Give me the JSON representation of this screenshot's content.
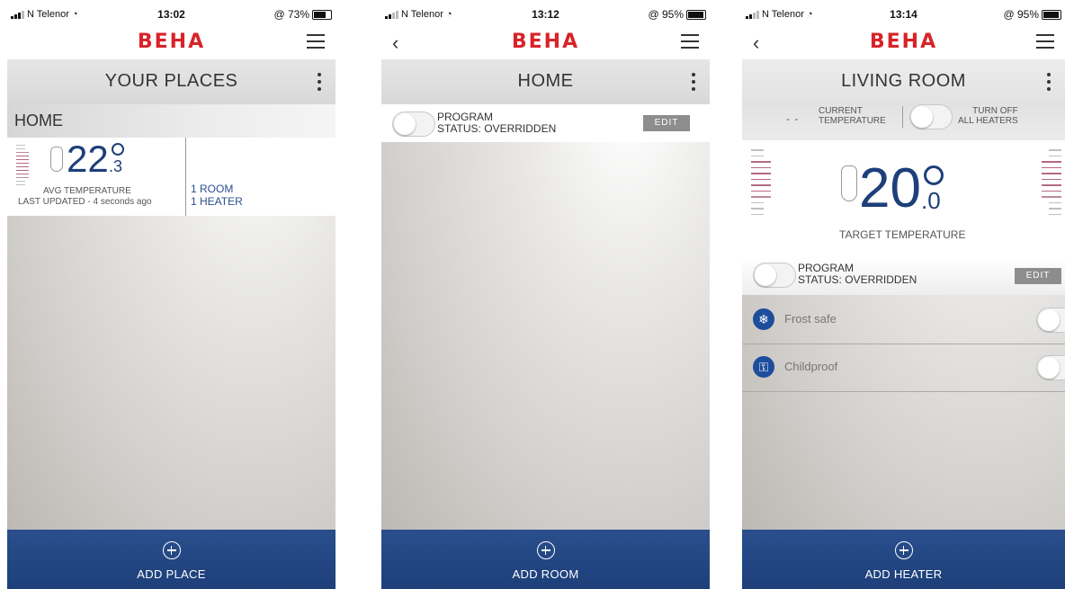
{
  "screens": [
    {
      "status": {
        "carrier": "N Telenor",
        "time": "13:02",
        "battery": "@ 73%",
        "battery_level": 0.73
      },
      "title": "YOUR PLACES",
      "place_name": "HOME",
      "avg_temp_int": "22",
      "avg_temp_dec": ".3",
      "avg_label": "AVG TEMPERATURE",
      "last_updated": "LAST UPDATED - 4 seconds ago",
      "rooms": "1 ROOM",
      "heaters": "1 HEATER",
      "bottom_label": "ADD PLACE"
    },
    {
      "status": {
        "carrier": "N Telenor",
        "time": "13:12",
        "battery": "@ 95%",
        "battery_level": 0.95
      },
      "title": "HOME",
      "program_label": "PROGRAM",
      "program_status": "STATUS: OVERRIDDEN",
      "edit_label": "EDIT",
      "bottom_label": "ADD ROOM"
    },
    {
      "status": {
        "carrier": "N Telenor",
        "time": "13:14",
        "battery": "@ 95%",
        "battery_level": 0.95
      },
      "title": "LIVING ROOM",
      "current_temp_line1": "CURRENT",
      "current_temp_line2": "TEMPERATURE",
      "current_temp_value": "- -",
      "turn_off_line1": "TURN OFF",
      "turn_off_line2": "ALL HEATERS",
      "target_temp_int": "20",
      "target_temp_dec": ".0",
      "target_label": "TARGET TEMPERATURE",
      "program_label": "PROGRAM",
      "program_status": "STATUS: OVERRIDDEN",
      "edit_label": "EDIT",
      "frost_safe": "Frost safe",
      "childproof": "Childproof",
      "bottom_label": "ADD HEATER"
    }
  ],
  "brand": {
    "logo": "BEHA",
    "logo_color": "#d8232a",
    "accent": "#1d3f7a"
  }
}
